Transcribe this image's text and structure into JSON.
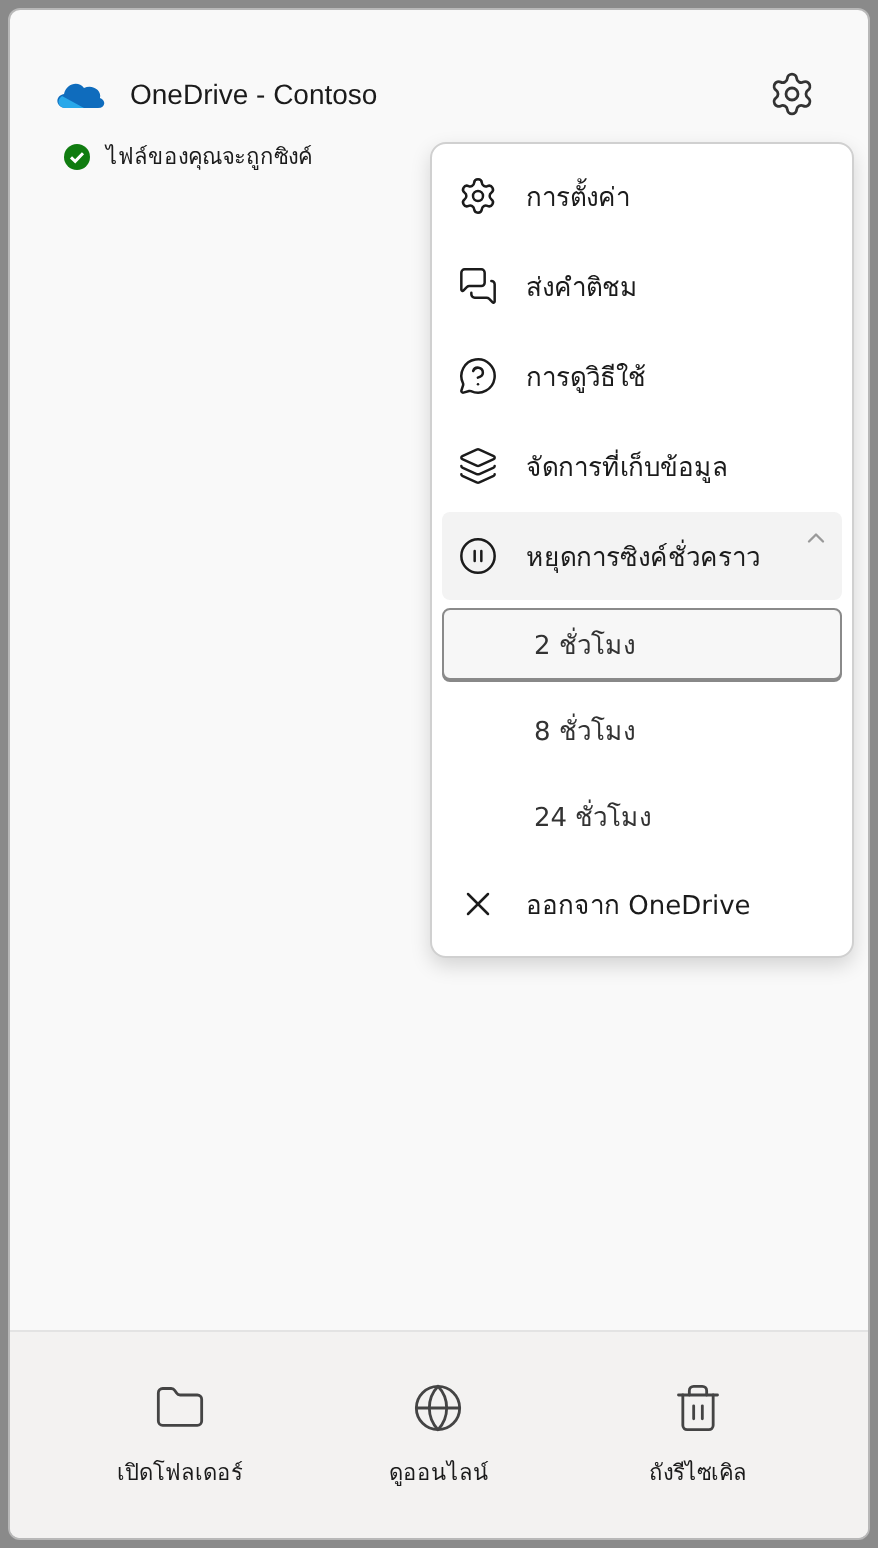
{
  "header": {
    "title": "OneDrive - Contoso",
    "status": "ไฟล์ของคุณจะถูกซิงค์"
  },
  "menu": [
    {
      "kind": "settings",
      "label": "การตั้งค่า"
    },
    {
      "kind": "feedback",
      "label": "ส่งคำติชม"
    },
    {
      "kind": "help",
      "label": "การดูวิธีใช้"
    },
    {
      "kind": "storage",
      "label": "จัดการที่เก็บข้อมูล"
    },
    {
      "kind": "pause",
      "label": "หยุดการซิงค์ชั่วคราว",
      "expanded": true,
      "children": [
        {
          "label": "2 ชั่วโมง",
          "selected": true
        },
        {
          "label": "8 ชั่วโมง",
          "selected": false
        },
        {
          "label": "24 ชั่วโมง",
          "selected": false
        }
      ]
    },
    {
      "kind": "quit",
      "label": "ออกจาก OneDrive"
    }
  ],
  "footer": [
    {
      "kind": "folder",
      "label": "เปิดโฟลเดอร์"
    },
    {
      "kind": "globe",
      "label": "ดูออนไลน์"
    },
    {
      "kind": "recycle",
      "label": "ถังรีไซเคิล"
    }
  ]
}
